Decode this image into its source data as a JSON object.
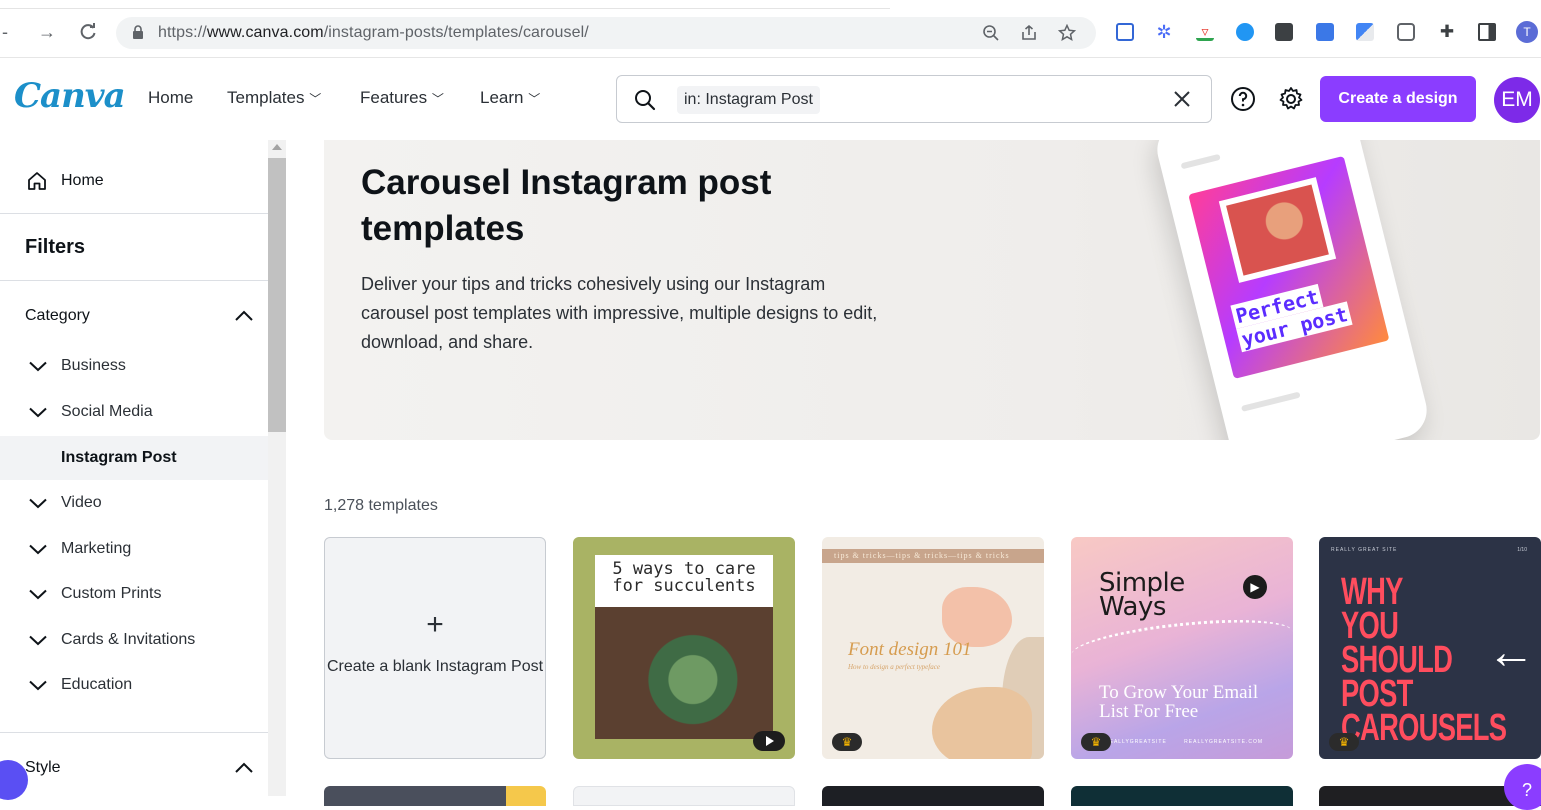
{
  "browser": {
    "url_prefix": "https://",
    "url_host": "www.canva.com",
    "url_path": "/instagram-posts/templates/carousel/"
  },
  "header": {
    "logo": "Canva",
    "nav": [
      "Home",
      "Templates",
      "Features",
      "Learn"
    ],
    "search_chip": "in: Instagram Post",
    "create_label": "Create a design",
    "avatar_initials": "EM"
  },
  "sidebar": {
    "home": "Home",
    "filters": "Filters",
    "category": "Category",
    "items": [
      {
        "label": "Business"
      },
      {
        "label": "Social Media"
      },
      {
        "label": "Instagram Post"
      },
      {
        "label": "Video"
      },
      {
        "label": "Marketing"
      },
      {
        "label": "Custom Prints"
      },
      {
        "label": "Cards & Invitations"
      },
      {
        "label": "Education"
      }
    ],
    "style": "Style"
  },
  "hero": {
    "title": "Carousel Instagram post templates",
    "description": "Deliver your tips and tricks cohesively using our Instagram carousel post templates with impressive, multiple designs to edit, download, and share.",
    "phone_line1": "Perfect",
    "phone_line2": "your post"
  },
  "results": {
    "count": "1,278 templates",
    "blank_plus": "+",
    "blank_label": "Create a blank Instagram Post",
    "t1_title": "5 ways to care for succulents",
    "t2_strip": "tips & tricks—tips & tricks—tips & tricks",
    "t2_title": "Font design 101",
    "t2_sub": "How to design a perfect typeface",
    "t3_title": "Simple Ways",
    "t3_sub": "To Grow Your Email List For Free",
    "t3_foot": "REALLYGREATSITE",
    "t3_foot2": "REALLYGREATSITE.COM",
    "t4_mini": "REALLY GREAT SITE",
    "t4_page": "1/10",
    "t4_title": "WHY YOU SHOULD POST CAROUSELS",
    "crown": "♛",
    "help_fab": "?"
  },
  "colors": {
    "brand_purple": "#8b3dff",
    "logo_blue": "#1c8fc9",
    "avatar": "#7d2ae8"
  }
}
